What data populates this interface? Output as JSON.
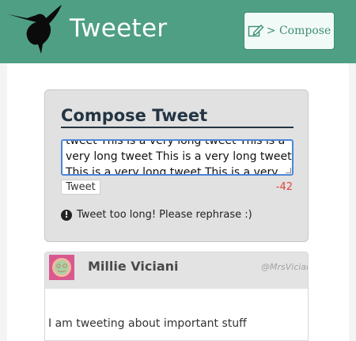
{
  "header": {
    "brand": "Tweeter",
    "compose_label": "> Compose"
  },
  "compose": {
    "title": "Compose Tweet",
    "textarea_value": "tweet This is a very long tweet This is a very long tweet This is a very long tweet This is a very long tweet This is a very long tweet",
    "submit_label": "Tweet",
    "counter": "-42",
    "error_text": "Tweet too long! Please rephrase :)"
  },
  "tweets": [
    {
      "name": "Millie Viciani",
      "handle": "@MrsViciani",
      "body": "I am tweeting about important stuff"
    }
  ],
  "colors": {
    "header_bg": "#4f9f85",
    "accent": "#3f8d75",
    "input_focus": "#4b86d9",
    "counter_error": "#e0463a",
    "title": "#233442"
  },
  "icons": {
    "logo": "hummingbird-icon",
    "compose": "pencil-square-icon",
    "error": "exclamation-circle-icon",
    "avatar": "avatar-icon"
  }
}
